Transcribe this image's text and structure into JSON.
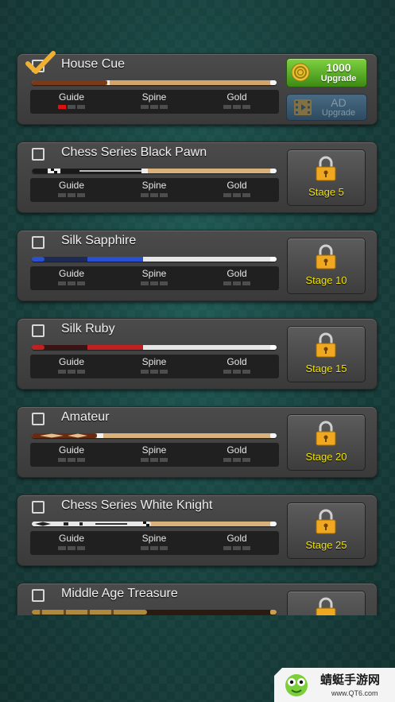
{
  "stat_labels": {
    "guide": "Guide",
    "spine": "Spine",
    "gold": "Gold"
  },
  "cues": [
    {
      "name": "House Cue",
      "selected": true,
      "guide_level": 1,
      "spine_level": 0,
      "gold_level": 0,
      "upgrade": {
        "amount": "1000",
        "label": "Upgrade"
      },
      "ad": {
        "title": "AD",
        "label": "Upgrade"
      }
    },
    {
      "name": "Chess Series Black Pawn",
      "selected": false,
      "locked": true,
      "stage": "Stage 5"
    },
    {
      "name": "Silk Sapphire",
      "selected": false,
      "locked": true,
      "stage": "Stage 10"
    },
    {
      "name": "Silk Ruby",
      "selected": false,
      "locked": true,
      "stage": "Stage 15"
    },
    {
      "name": "Amateur",
      "selected": false,
      "locked": true,
      "stage": "Stage 20"
    },
    {
      "name": "Chess Series White Knight",
      "selected": false,
      "locked": true,
      "stage": "Stage 25"
    },
    {
      "name": "Middle Age Treasure",
      "selected": false,
      "locked": true,
      "stage": ""
    }
  ],
  "watermark": {
    "text": "蜻蜓手游网",
    "url": "www.QT6.com"
  },
  "colors": {
    "stage_text": "#f2e400",
    "bar_on": "#e01010",
    "upgrade_green": "#5fb02a"
  }
}
